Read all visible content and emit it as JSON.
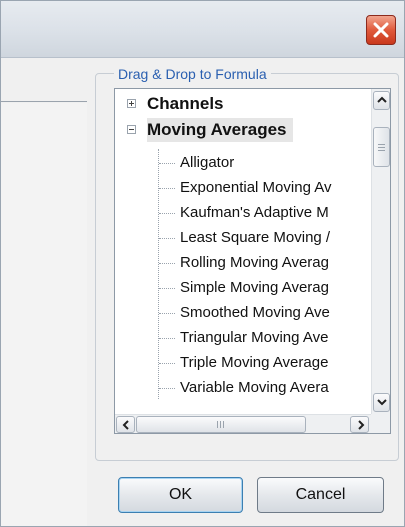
{
  "dialog": {
    "close_icon": "close-x-icon",
    "close_color": "#e05a3c"
  },
  "panel": {
    "legend": "Drag & Drop to Formula",
    "legend_color": "#2a5fb0"
  },
  "tree": {
    "groups": [
      {
        "label": "Channels",
        "state": "collapsed",
        "icon": "plus-expander-icon"
      },
      {
        "label": "Moving Averages",
        "state": "expanded",
        "icon": "minus-expander-icon"
      }
    ],
    "items": [
      "Alligator",
      "Exponential Moving Av",
      "Kaufman's Adaptive M",
      "Least Square Moving /",
      "Rolling Moving Averag",
      "Simple Moving Averag",
      "Smoothed Moving Ave",
      "Triangular Moving Ave",
      "Triple Moving Average",
      "Variable Moving Avera"
    ]
  },
  "buttons": {
    "ok": "OK",
    "cancel": "Cancel"
  }
}
